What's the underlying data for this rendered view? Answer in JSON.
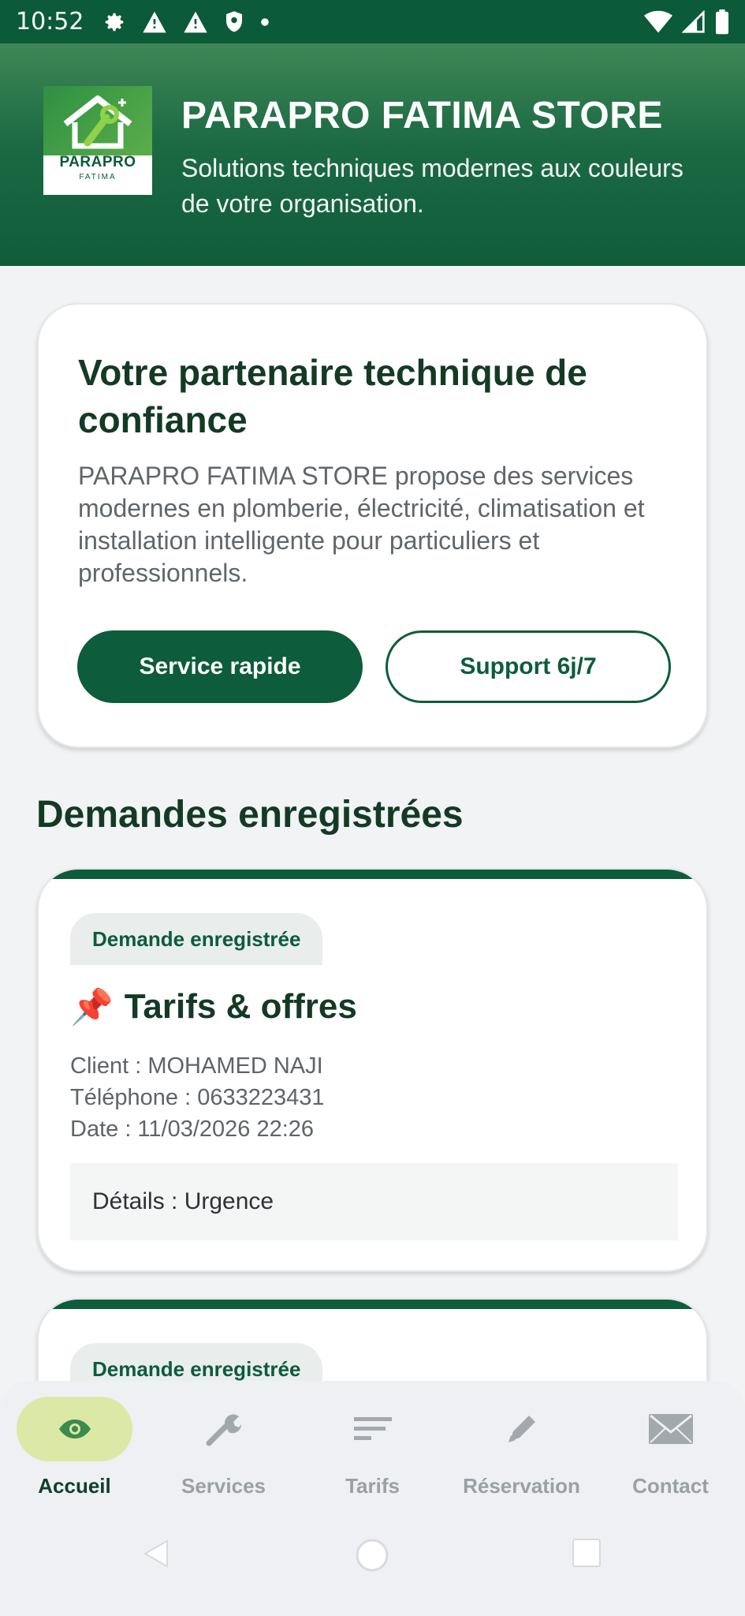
{
  "status_bar": {
    "time": "10:52"
  },
  "header": {
    "logo_text": "PARAPRO",
    "logo_subtext": "FATIMA",
    "title": "PARAPRO FATIMA STORE",
    "subtitle": "Solutions techniques modernes aux couleurs de votre organisation."
  },
  "hero": {
    "title": "Votre partenaire technique de confiance",
    "description": "PARAPRO FATIMA STORE propose des services modernes en plomberie, électricité, climatisation et installation intelligente pour particuliers et professionnels.",
    "primary_button": "Service rapide",
    "secondary_button": "Support 6j/7"
  },
  "requests_section": {
    "title": "Demandes enregistrées",
    "items": [
      {
        "badge": "Demande enregistrée",
        "emoji": "📌",
        "title": "Tarifs & offres",
        "client": "Client : MOHAMED NAJI",
        "phone": "Téléphone : 0633223431",
        "date": "Date : 11/03/2026 22:26",
        "details": "Détails : Urgence"
      },
      {
        "badge": "Demande enregistrée"
      }
    ]
  },
  "bottom_nav": {
    "items": [
      {
        "label": "Accueil",
        "icon": "eye-icon",
        "active": true
      },
      {
        "label": "Services",
        "icon": "wrench-icon",
        "active": false
      },
      {
        "label": "Tarifs",
        "icon": "lines-icon",
        "active": false
      },
      {
        "label": "Réservation",
        "icon": "pencil-icon",
        "active": false
      },
      {
        "label": "Contact",
        "icon": "envelope-icon",
        "active": false
      }
    ]
  },
  "colors": {
    "brand_green": "#0d5c3b",
    "active_pill": "#dbe8a6",
    "heading_text": "#143a24"
  }
}
